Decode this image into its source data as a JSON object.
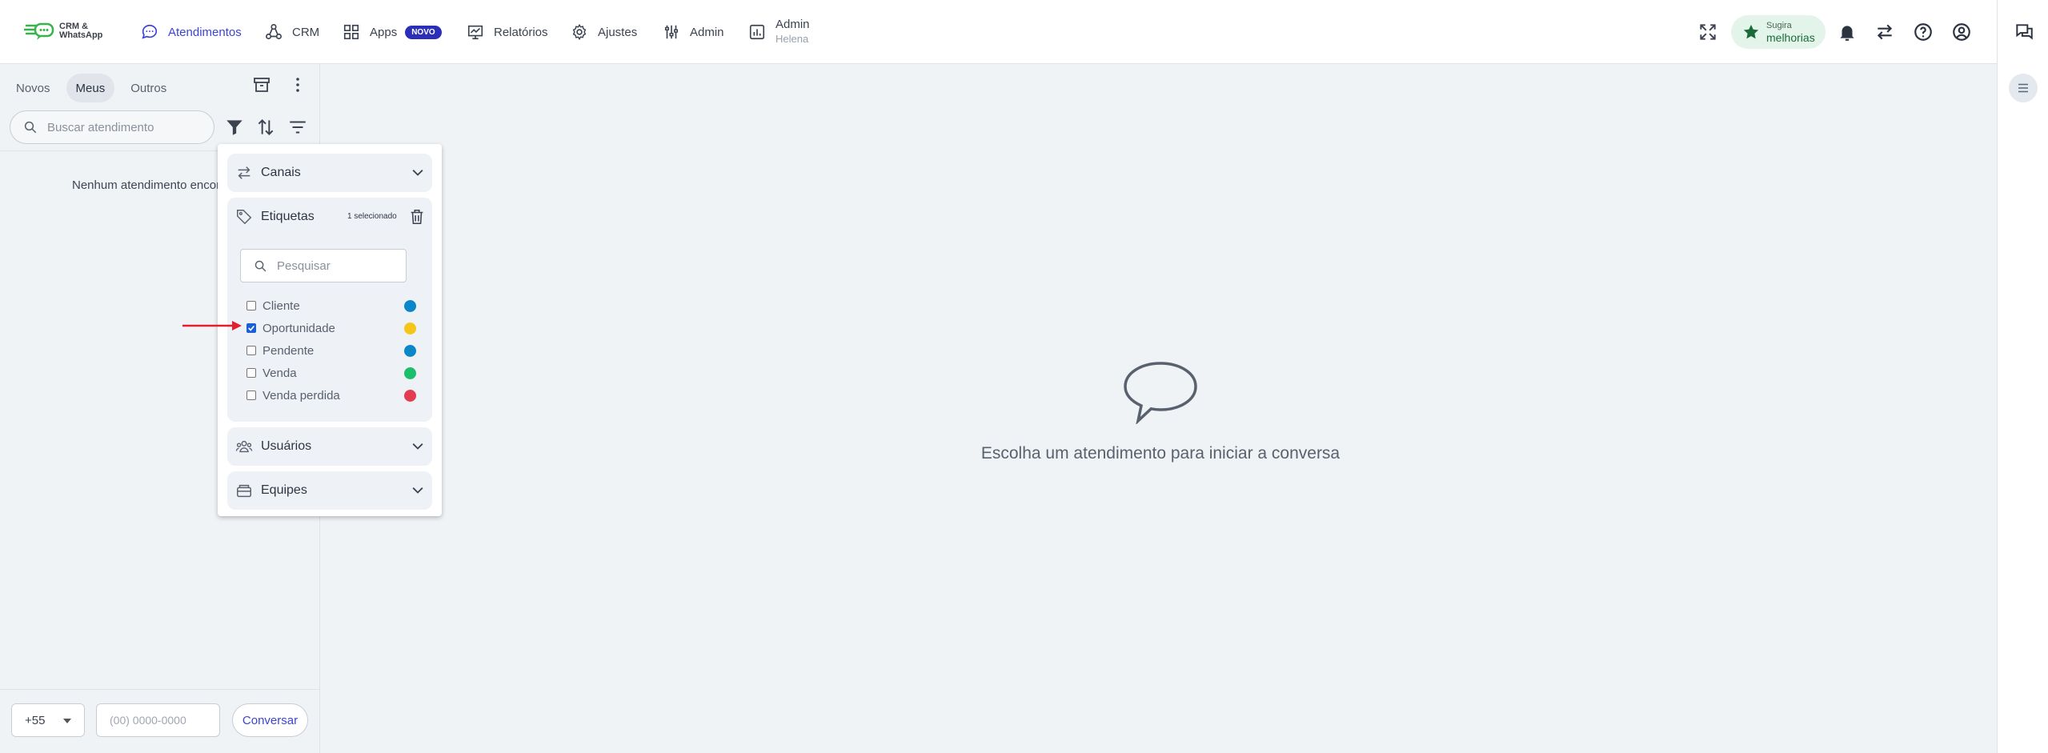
{
  "brand": {
    "logo_line1": "CRM &",
    "logo_line2": "WhatsApp"
  },
  "nav": {
    "atendimentos": "Atendimentos",
    "crm": "CRM",
    "apps": "Apps",
    "apps_badge": "NOVO",
    "relatorios": "Relatórios",
    "ajustes": "Ajustes",
    "admin": "Admin",
    "admin_account": "Admin",
    "admin_user": "Helena"
  },
  "suggest": {
    "line1": "Sugira",
    "line2": "melhorias"
  },
  "left": {
    "tabs": [
      "Novos",
      "Meus",
      "Outros"
    ],
    "active_tab": "Meus",
    "search_placeholder": "Buscar atendimento",
    "empty_message": "Nenhum atendimento encontrado",
    "country_code": "+55",
    "phone_placeholder": "(00) 0000-0000",
    "start_button": "Conversar"
  },
  "filters": {
    "canais": "Canais",
    "etiquetas": "Etiquetas",
    "selected_count": "1 selecionado",
    "tag_search_placeholder": "Pesquisar",
    "tags": [
      {
        "label": "Cliente",
        "checked": false,
        "color": "#0a87c8"
      },
      {
        "label": "Oportunidade",
        "checked": true,
        "color": "#f5c518"
      },
      {
        "label": "Pendente",
        "checked": false,
        "color": "#0a87c8"
      },
      {
        "label": "Venda",
        "checked": false,
        "color": "#1bbf6b"
      },
      {
        "label": "Venda perdida",
        "checked": false,
        "color": "#e33b4f"
      }
    ],
    "usuarios": "Usuários",
    "equipes": "Equipes"
  },
  "main": {
    "empty_message": "Escolha um atendimento para iniciar a conversa"
  },
  "colors": {
    "accent": "#3c44d8",
    "annotation_arrow": "#e0202f"
  }
}
